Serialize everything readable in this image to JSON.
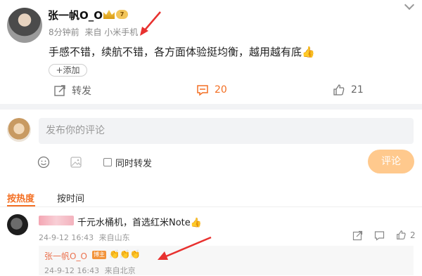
{
  "post": {
    "author": "张一帆O_O",
    "vip_level": "7",
    "time": "8分钟前",
    "source": "来自 小米手机",
    "content": "手感不错，续航不错，各方面体验挺均衡，越用越有底👍",
    "add_tag": "+添加",
    "actions": {
      "repost_label": "转发",
      "comment_count": "20",
      "like_count": "21"
    }
  },
  "composer": {
    "placeholder": "发布你的评论",
    "also_repost_label": "同时转发",
    "submit_label": "评论"
  },
  "sort_tabs": {
    "hot": "按热度",
    "time": "按时间"
  },
  "comments": [
    {
      "text": "千元水桶机，首选红米Note👍",
      "date": "24-9-12 16:43",
      "location": "来自山东",
      "like_count": "2",
      "reply": {
        "user": "张一帆O_O",
        "badge": "博主",
        "text": "👏👏👏",
        "date": "24-9-12 16:43",
        "location": "来自北京"
      }
    }
  ],
  "colors": {
    "accent": "#f36f23",
    "annotation_arrow": "#e8312f",
    "submit_disabled": "#ffc98d"
  },
  "icons": [
    "chevron-down-icon",
    "repost-icon",
    "comment-icon",
    "like-icon",
    "emoji-icon",
    "image-icon",
    "share-icon",
    "reply-icon"
  ]
}
